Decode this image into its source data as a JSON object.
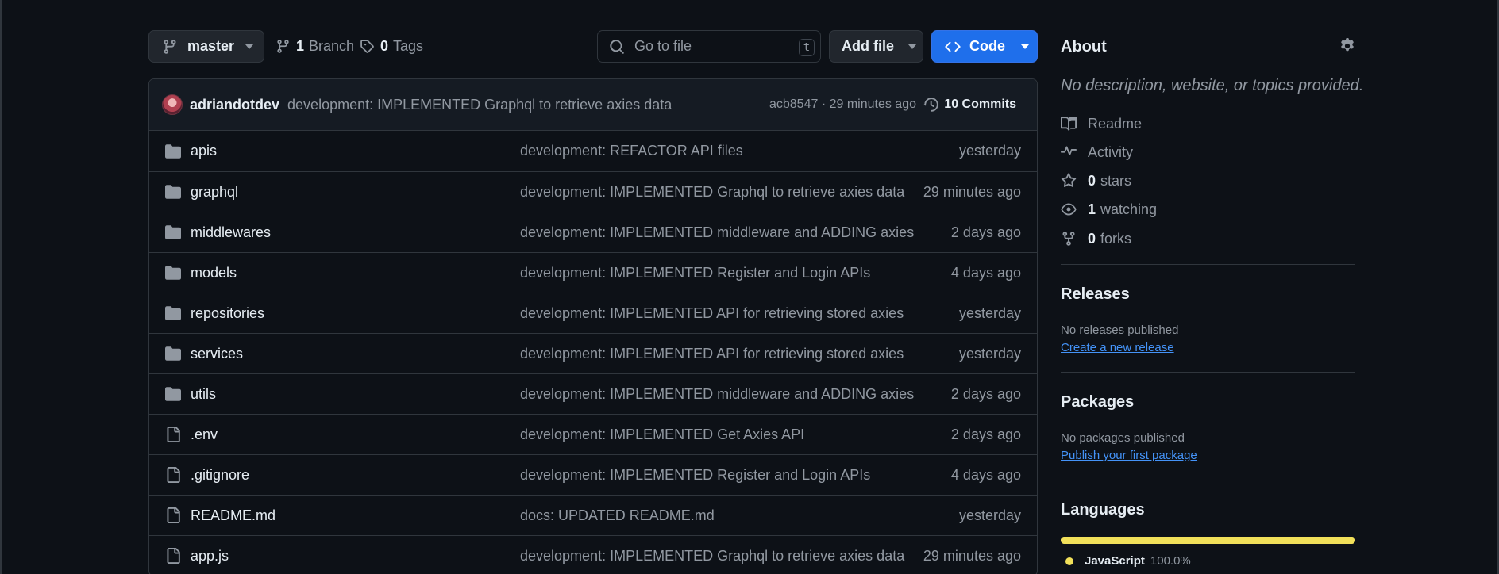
{
  "toolbar": {
    "branch_name": "master",
    "branches_count": "1",
    "branches_label": "Branch",
    "tags_count": "0",
    "tags_label": "Tags",
    "search_placeholder": "Go to file",
    "search_shortcut": "t",
    "add_file_label": "Add file",
    "code_label": "Code"
  },
  "commit": {
    "author": "adriandotdev",
    "message": "development: IMPLEMENTED Graphql to retrieve axies data",
    "meta": "acb8547 · 29 minutes ago",
    "commits_label": "10 Commits"
  },
  "files": [
    {
      "type": "folder",
      "name": "apis",
      "message": "development: REFACTOR API files",
      "age": "yesterday"
    },
    {
      "type": "folder",
      "name": "graphql",
      "message": "development: IMPLEMENTED Graphql to retrieve axies data",
      "age": "29 minutes ago"
    },
    {
      "type": "folder",
      "name": "middlewares",
      "message": "development: IMPLEMENTED middleware and ADDING axies",
      "age": "2 days ago"
    },
    {
      "type": "folder",
      "name": "models",
      "message": "development: IMPLEMENTED Register and Login APIs",
      "age": "4 days ago"
    },
    {
      "type": "folder",
      "name": "repositories",
      "message": "development: IMPLEMENTED API for retrieving stored axies",
      "age": "yesterday"
    },
    {
      "type": "folder",
      "name": "services",
      "message": "development: IMPLEMENTED API for retrieving stored axies",
      "age": "yesterday"
    },
    {
      "type": "folder",
      "name": "utils",
      "message": "development: IMPLEMENTED middleware and ADDING axies",
      "age": "2 days ago"
    },
    {
      "type": "file",
      "name": ".env",
      "message": "development: IMPLEMENTED Get Axies API",
      "age": "2 days ago"
    },
    {
      "type": "file",
      "name": ".gitignore",
      "message": "development: IMPLEMENTED Register and Login APIs",
      "age": "4 days ago"
    },
    {
      "type": "file",
      "name": "README.md",
      "message": "docs: UPDATED README.md",
      "age": "yesterday"
    },
    {
      "type": "file",
      "name": "app.js",
      "message": "development: IMPLEMENTED Graphql to retrieve axies data",
      "age": "29 minutes ago"
    }
  ],
  "about": {
    "title": "About",
    "description": "No description, website, or topics provided.",
    "readme_label": "Readme",
    "activity_label": "Activity",
    "stars_count": "0",
    "stars_label": "stars",
    "watching_count": "1",
    "watching_label": "watching",
    "forks_count": "0",
    "forks_label": "forks"
  },
  "releases": {
    "title": "Releases",
    "empty_text": "No releases published",
    "link_label": "Create a new release"
  },
  "packages": {
    "title": "Packages",
    "empty_text": "No packages published",
    "link_label": "Publish your first package"
  },
  "languages": {
    "title": "Languages",
    "items": [
      {
        "name": "JavaScript",
        "percent": "100.0%",
        "color": "#f1e05a",
        "fraction": 1.0
      }
    ]
  },
  "colors": {
    "background": "#0d1117",
    "accent_button": "#1f6feb",
    "link": "#4493f8",
    "javascript": "#f1e05a"
  }
}
